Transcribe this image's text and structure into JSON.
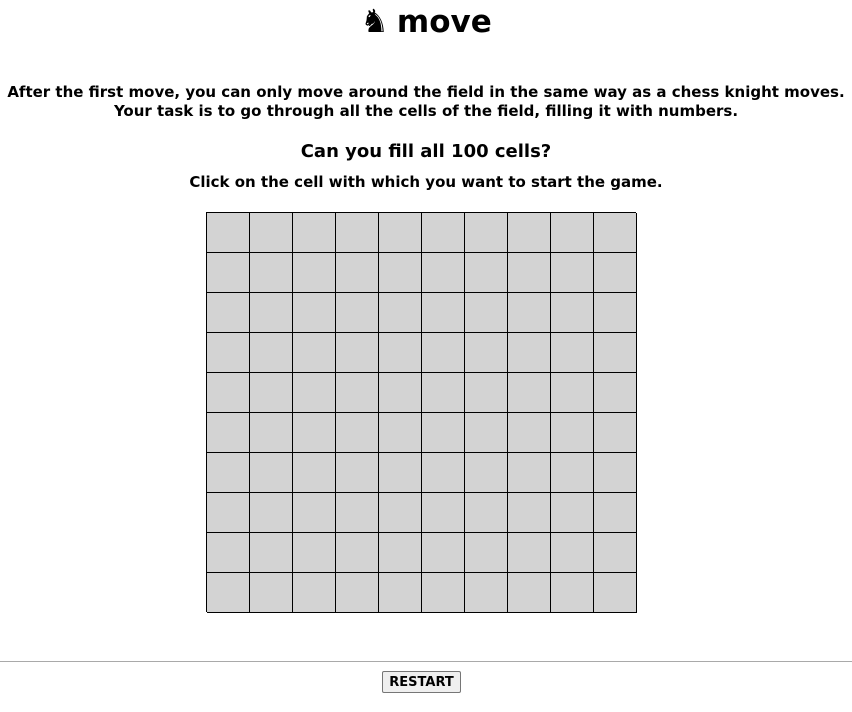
{
  "header": {
    "title": "move",
    "knight_icon": "black-chess-knight-icon",
    "knight_glyph": "♞"
  },
  "instructions": {
    "line1": "After the first move, you can only move around the field in the same way as a chess knight moves.",
    "line2": "Your task is to go through all the cells of the field, filling it with numbers."
  },
  "question": "Can you fill all 100 cells?",
  "hint": "Click on the cell with which you want to start the game.",
  "board": {
    "rows": 10,
    "cols": 10,
    "cell_color": "#d3d3d3",
    "border_color": "#000000",
    "cells_filled": 0
  },
  "footer": {
    "restart_label": "RESTART"
  }
}
